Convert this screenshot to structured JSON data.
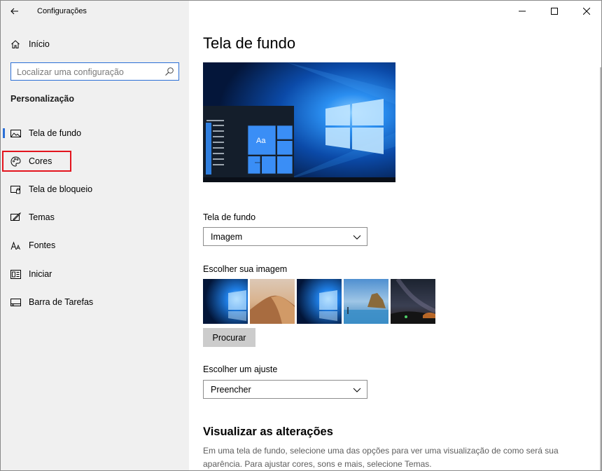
{
  "app": {
    "title": "Configurações"
  },
  "sidebar": {
    "home_label": "Início",
    "search_placeholder": "Localizar uma configuração",
    "section_title": "Personalização",
    "items": [
      {
        "label": "Tela de fundo",
        "icon": "image-icon",
        "active": true
      },
      {
        "label": "Cores",
        "icon": "palette-icon",
        "highlighted": true
      },
      {
        "label": "Tela de bloqueio",
        "icon": "lock-screen-icon"
      },
      {
        "label": "Temas",
        "icon": "themes-icon"
      },
      {
        "label": "Fontes",
        "icon": "fonts-icon"
      },
      {
        "label": "Iniciar",
        "icon": "start-icon"
      },
      {
        "label": "Barra de Tarefas",
        "icon": "taskbar-icon"
      }
    ]
  },
  "main": {
    "title": "Tela de fundo",
    "preview": {
      "tile_text": "Aa"
    },
    "background": {
      "label": "Tela de fundo",
      "value": "Imagem"
    },
    "choose_image": {
      "label": "Escolher sua imagem",
      "browse_label": "Procurar"
    },
    "fit": {
      "label": "Escolher um ajuste",
      "value": "Preencher"
    },
    "preview_changes": {
      "title": "Visualizar as alterações",
      "description": "Em uma tela de fundo, selecione uma das opções para ver uma visualização de como será sua aparência. Para ajustar cores, sons e mais, selecione Temas."
    }
  },
  "colors": {
    "accent": "#2b6fd6",
    "highlight": "#e3141e",
    "sidebar_bg": "#f0f0f0"
  }
}
